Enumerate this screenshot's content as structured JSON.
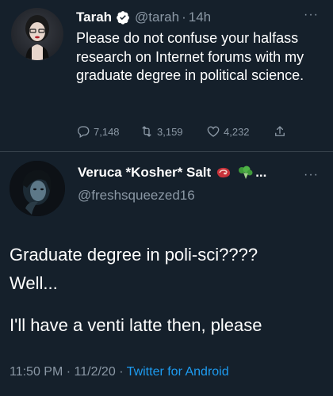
{
  "tweet": {
    "author_name": "Tarah",
    "handle": "@tarah",
    "separator": "·",
    "time": "14h",
    "more": "···",
    "text": "Please do not confuse your halfass research on Internet forums with my graduate degree in political science.",
    "replies": "7,148",
    "retweets": "3,159",
    "likes": "4,232",
    "icons": [
      "verified-icon",
      "reply-icon",
      "retweet-icon",
      "like-icon",
      "share-icon",
      "more-icon"
    ]
  },
  "reply": {
    "author_name": "Veruca *Kosher* Salt",
    "name_emojis": [
      "steak",
      "broccoli"
    ],
    "name_ellipsis": "...",
    "handle": "@freshsqueezed16",
    "more": "···",
    "lines": [
      "Graduate degree in poli-sci????",
      "Well...",
      "I'll have a venti latte then, please"
    ],
    "time": "11:50 PM",
    "date": "11/2/20",
    "separator": "·",
    "source": "Twitter for Android"
  },
  "colors": {
    "background": "#15202b",
    "text": "#ffffff",
    "muted": "#8b98a5",
    "accent": "#1d9bf0",
    "divider": "#38444d"
  }
}
